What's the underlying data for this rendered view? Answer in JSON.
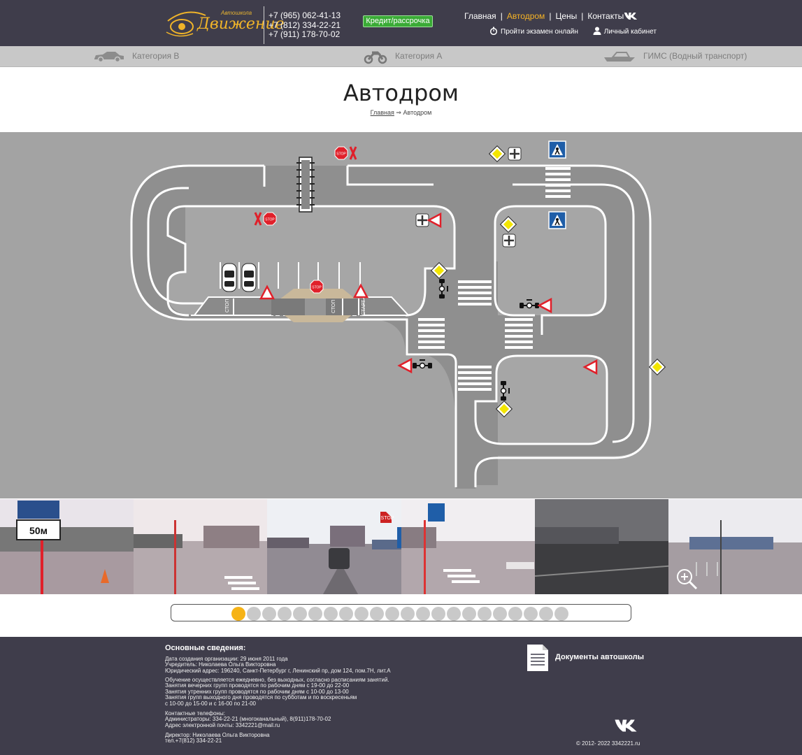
{
  "header": {
    "logo_subtitle": "Автошкола",
    "logo_name": "Движение",
    "phones": [
      "+7 (965) 062-41-13",
      "+7 (812) 334-22-21",
      "+7 (911) 178-70-02"
    ],
    "credit_button": "Кредит/рассрочка",
    "nav": [
      {
        "label": "Главная",
        "active": false
      },
      {
        "label": "Автодром",
        "active": true
      },
      {
        "label": "Цены",
        "active": false
      },
      {
        "label": "Контакты",
        "active": false
      }
    ],
    "exam_link": "Пройти экзамен онлайн",
    "cabinet_link": "Личный кабинет",
    "accent_color": "#f5b326"
  },
  "categories": [
    {
      "label": "Категория B",
      "icon": "car-icon"
    },
    {
      "label": "Категория A",
      "icon": "motorcycle-icon"
    },
    {
      "label": "ГИМС (Водный транспорт)",
      "icon": "boat-icon"
    }
  ],
  "page": {
    "title": "Автодром",
    "breadcrumb_home": "Главная",
    "breadcrumb_arrow": "⇒",
    "breadcrumb_current": "Автодром"
  },
  "map": {
    "labels": [
      "СТОП",
      "СТОП",
      "СТАРТ",
      "STOP",
      "STOP",
      "STOP"
    ]
  },
  "photos": [
    {
      "caption": "50м"
    },
    {
      "caption": ""
    },
    {
      "caption": "STOP"
    },
    {
      "caption": ""
    },
    {
      "caption": ""
    },
    {
      "caption": ""
    }
  ],
  "pager": {
    "count": 22,
    "active_index": 0
  },
  "footer": {
    "title": "Основные сведения:",
    "block1": [
      "Дата создания организации: 29 июня 2011 года",
      "Учредитель: Николаева Ольга Викторовна",
      "Юридический адрес: 196240, Санкт-Петербург г, Ленинский пр, дом 124, пом.7Н, лит.А"
    ],
    "block2": [
      "Обучение осуществляется ежедневно, без выходных, согласно расписаниям занятий.",
      "Занятия вечерних групп проводятся по рабочим дням с 19-00 до 22-00",
      "Занятия утренних групп проводятся по рабочим дням с 10-00 до 13-00",
      "Занятия групп выходного дня проводятся по субботам и по воскресеньям",
      "с 10-00 до 15-00 и с 16-00 по 21-00"
    ],
    "block3": [
      "Контактные телефоны:",
      "Администраторы: 334-22-21 (многоканальный), 8(911)178-70-02",
      "Адрес электронной почты: 3342221@mail.ru"
    ],
    "block4": [
      "Директор: Николаева Ольга Викторовна",
      "тел.+7(812) 334-22-21"
    ],
    "docs_label": "Документы автошколы",
    "copyright": "© 2012- 2022 3342221.ru"
  }
}
